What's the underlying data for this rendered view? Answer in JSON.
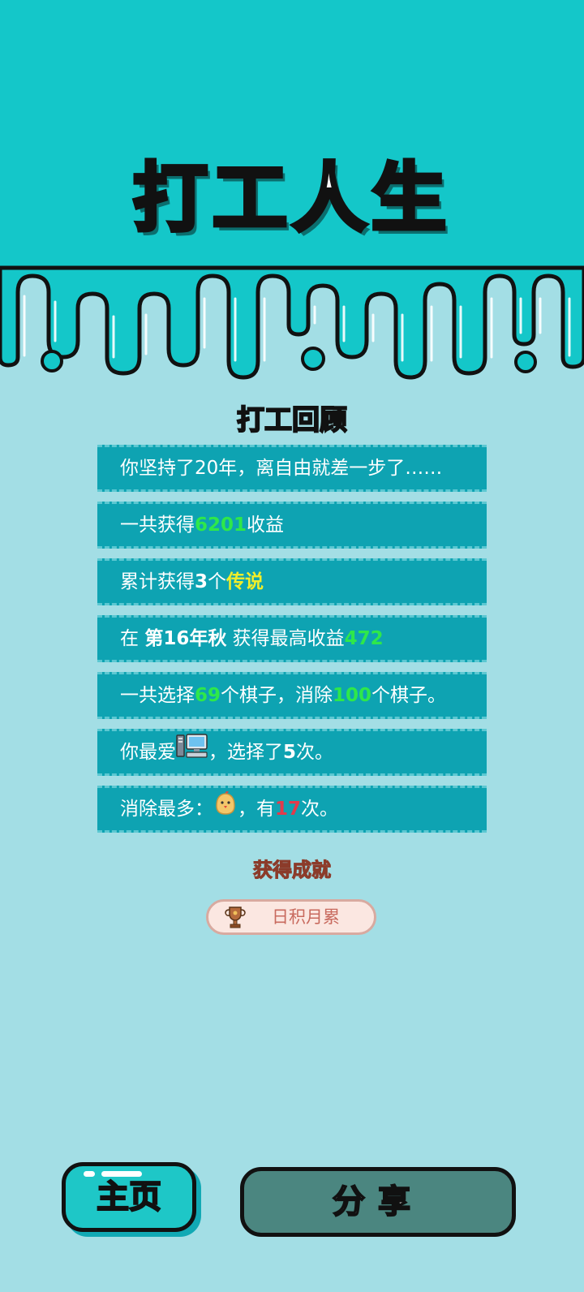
{
  "colors": {
    "primary": "#14c7c9",
    "background": "#a3dee5",
    "card": "#0ea3b2",
    "highlight_green": "#2ee84a",
    "highlight_yellow": "#f1ee2a",
    "highlight_red": "#e23b4c"
  },
  "header": {
    "title": "打工人生"
  },
  "review": {
    "title": "打工回顾",
    "line1": {
      "text": "你坚持了20年，离自由就差一步了……"
    },
    "line2": {
      "pre": "一共获得",
      "value": "6201",
      "post": "收益"
    },
    "line3": {
      "pre": "累计获得",
      "count": "3",
      "unit": "个",
      "rarity": "传说"
    },
    "line4": {
      "pre": "在 ",
      "period": "第16年秋",
      "mid": " 获得最高收益",
      "value": "472"
    },
    "line5": {
      "pre": "一共选择",
      "selected": "69",
      "mid": "个棋子，消除",
      "removed": "100",
      "post": "个棋子。"
    },
    "line6": {
      "pre": "你最爱",
      "icon": "computer-icon",
      "mid": "，选择了",
      "count": "5",
      "post": "次。"
    },
    "line7": {
      "pre": "消除最多：",
      "icon": "chick-icon",
      "mid": "，有",
      "count": "17",
      "post": "次。"
    }
  },
  "achievement": {
    "title": "获得成就",
    "badge_icon": "trophy-icon",
    "badge_label": "日积月累"
  },
  "buttons": {
    "home": "主页",
    "share": "分享"
  }
}
